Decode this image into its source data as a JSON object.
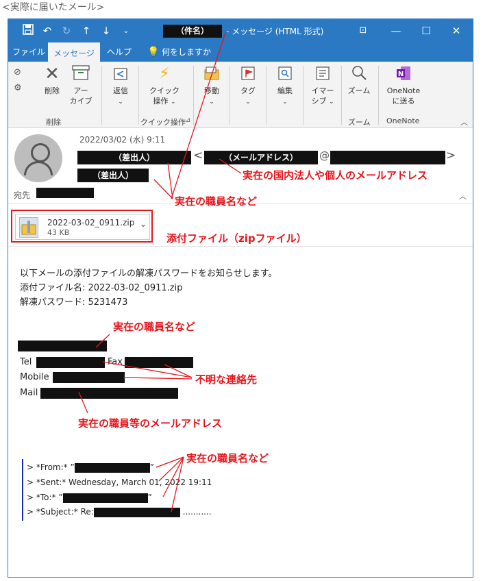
{
  "caption": "<実際に届いたメール>",
  "titlebar": {
    "subject_redacted": "（件名）",
    "title": "- メッセージ (HTML 形式)",
    "icons": [
      "save-icon",
      "undo-icon",
      "redo-icon",
      "up-icon",
      "down-icon",
      "customize-icon"
    ],
    "controls": [
      "ribbon-display-icon",
      "minimize-icon",
      "maximize-icon",
      "close-icon"
    ]
  },
  "menu": {
    "file": "ファイル",
    "message": "メッセージ",
    "help": "ヘルプ",
    "tell_me": "何をしますか"
  },
  "ribbon": {
    "delete": "削除",
    "archive_1": "アー",
    "archive_2": "カイブ",
    "group_delete": "削除",
    "reply": "返信",
    "quick_1": "クイック",
    "quick_2": "操作",
    "group_quick": "クイック操作",
    "move": "移動",
    "tags": "タグ",
    "edit": "編集",
    "immersive_1": "イマー",
    "immersive_2": "シブ",
    "zoom": "ズーム",
    "group_zoom": "ズーム",
    "onenote_1": "OneNote",
    "onenote_2": "に送る",
    "group_onenote": "OneNote"
  },
  "header": {
    "date": "2022/03/02 (水) 9:11",
    "sender_redacted": "（差出人）",
    "open_bracket": "<",
    "email_redacted": "（メールアドレス）",
    "at": "@",
    "close_bracket": ">",
    "sender2_redacted": "（差出人）",
    "to_label": "宛先"
  },
  "attachment": {
    "name": "2022-03-02_0911.zip",
    "size": "43 KB"
  },
  "annotations": {
    "email_real": "実在の国内法人や個人のメールアドレス",
    "staff_name_1": "実在の職員名など",
    "attachment": "添付ファイル（zipファイル）",
    "staff_name_2": "実在の職員名など",
    "unknown_contact": "不明な連絡先",
    "staff_email": "実在の職員等のメールアドレス",
    "staff_name_3": "実在の職員名など"
  },
  "body": {
    "line1": "以下メールの添付ファイルの解凍パスワードをお知らせします。",
    "line2": "添付ファイル名: 2022-03-02_0911.zip",
    "line3": "解凍パスワード: 5231473",
    "tel": "Tel",
    "fax": "Fax",
    "mobile": "Mobile",
    "mail": "Mail"
  },
  "quote": {
    "from": "> *From:* ”",
    "from_end": "”",
    "sent": "> *Sent:* Wednesday, March 01, 2022 19:11",
    "to": "> *To:* ”",
    "to_end": "”",
    "subject": "> *Subject:* Re:",
    "subject_end": "..........."
  },
  "colors": {
    "accent": "#2b79c2",
    "annotation_red": "#e6161c",
    "redaction": "#111111"
  }
}
